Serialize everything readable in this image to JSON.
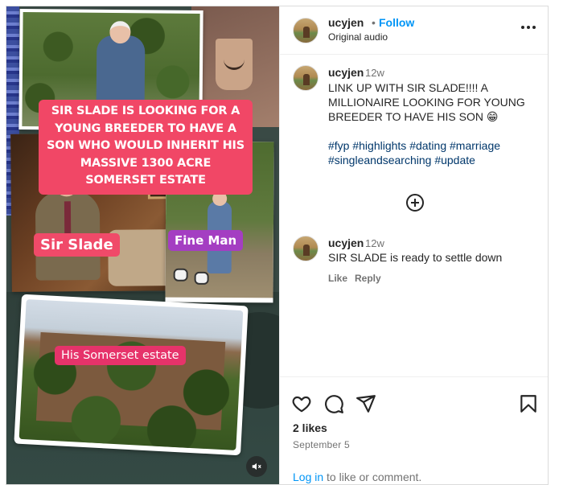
{
  "post": {
    "media": {
      "overlay_caption": "SIR SLADE IS LOOKING FOR A YOUNG BREEDER TO HAVE A SON WHO WOULD INHERIT HIS MASSIVE 1300 ACRE SOMERSET ESTATE",
      "label_left": "Sir Slade",
      "label_right": "Fine Man",
      "label_bottom": "His Somerset estate",
      "mute_icon": "speaker-muted-icon"
    },
    "header": {
      "username": "ucyjen",
      "separator": "•",
      "follow_label": "Follow",
      "audio_label": "Original audio",
      "more_icon": "more-options-icon"
    },
    "caption": {
      "username": "ucyjen",
      "time": "12w",
      "text": "LINK UP WITH SIR SLADE!!!! A MILLIONAIRE LOOKING FOR  YOUNG BREEDER TO HAVE HIS SON 😁",
      "hashtags": [
        "#fyp",
        "#highlights",
        "#dating",
        "#marriage",
        "#singleandsearching",
        "#update"
      ]
    },
    "load_more_icon": "plus-circle-icon",
    "comment": {
      "username": "ucyjen",
      "time": "12w",
      "text": "SIR SLADE is ready to settle down",
      "like_label": "Like",
      "reply_label": "Reply"
    },
    "actions": {
      "like_icon": "heart-icon",
      "comment_icon": "comment-icon",
      "share_icon": "share-icon",
      "save_icon": "bookmark-icon"
    },
    "likes_count": "2 likes",
    "date": "September 5",
    "login_prompt": {
      "link": "Log in",
      "rest": " to like or comment."
    }
  },
  "colors": {
    "follow_blue": "#0095f6",
    "hashtag_blue": "#00376b",
    "caption_pink": "#f14766",
    "label_purple": "#a43ec2"
  }
}
